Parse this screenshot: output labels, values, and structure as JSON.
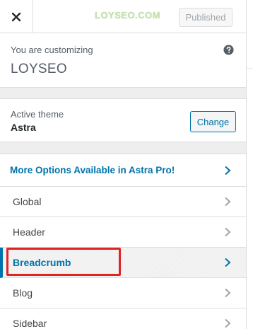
{
  "header": {
    "close_icon": "close-icon",
    "watermark": "LOYSEO.COM",
    "publish_label": "Published"
  },
  "info": {
    "label": "You are customizing",
    "site_title": "LOYSEO",
    "help_icon": "help-icon"
  },
  "theme": {
    "label": "Active theme",
    "name": "Astra",
    "change_label": "Change"
  },
  "menu": {
    "items": [
      {
        "label": "More Options Available in Astra Pro!",
        "type": "promo"
      },
      {
        "label": "Global"
      },
      {
        "label": "Header"
      },
      {
        "label": "Breadcrumb",
        "active": true,
        "highlighted": true
      },
      {
        "label": "Blog"
      },
      {
        "label": "Sidebar"
      }
    ]
  },
  "colors": {
    "accent": "#0073aa",
    "highlight": "#e02424"
  }
}
